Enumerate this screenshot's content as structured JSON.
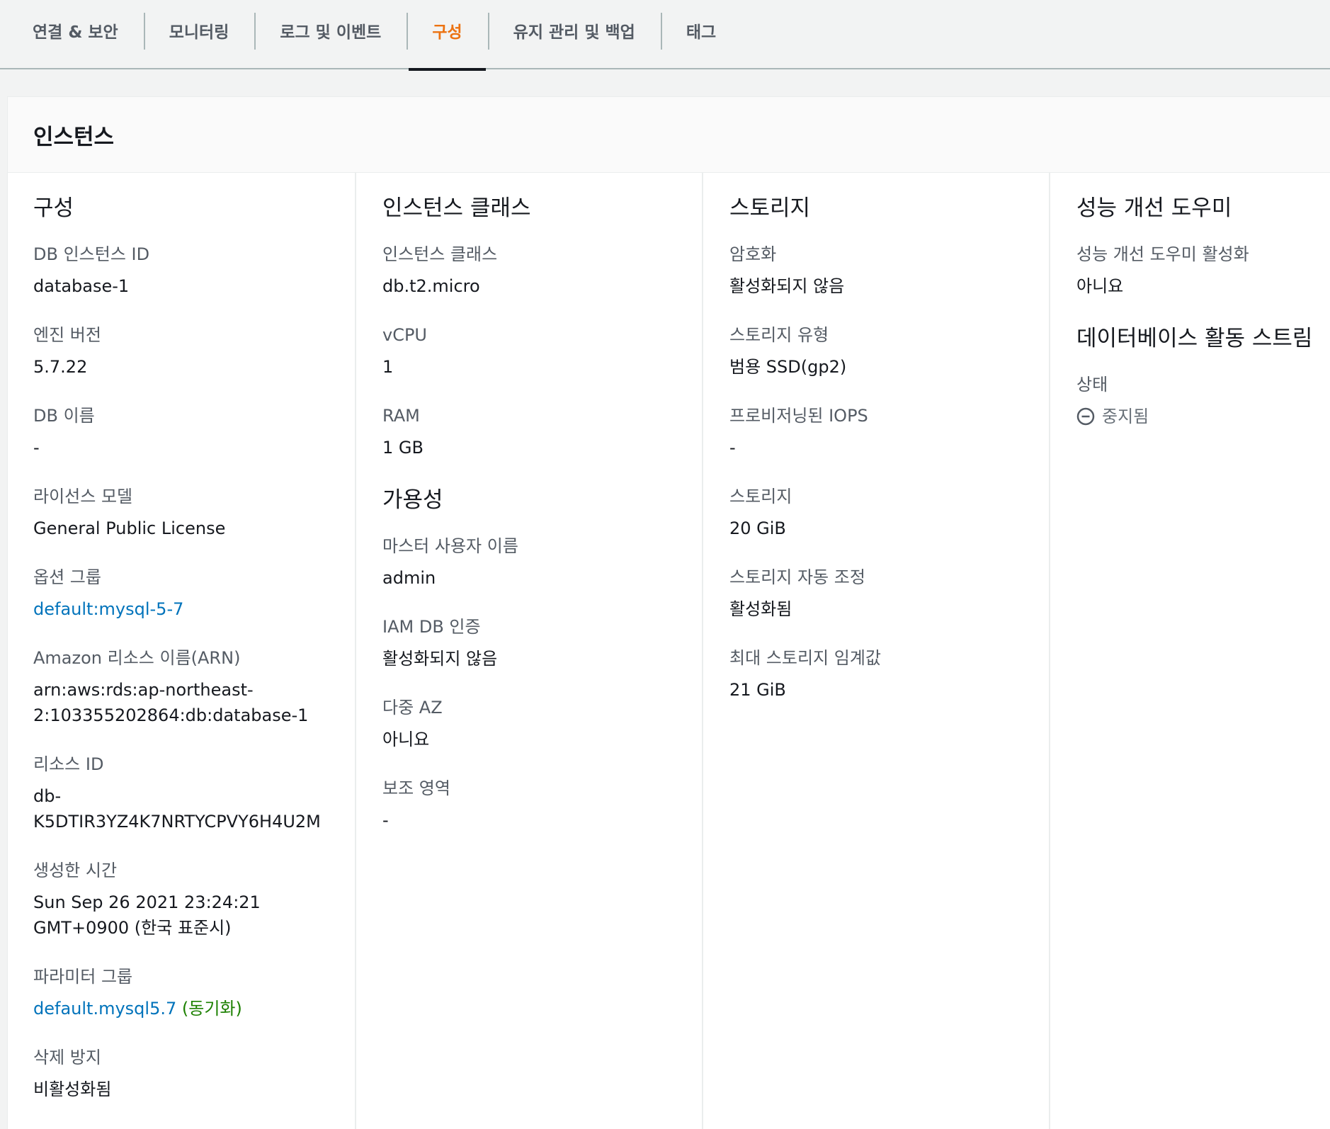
{
  "tabs": [
    {
      "label": "연결 & 보안",
      "active": false
    },
    {
      "label": "모니터링",
      "active": false
    },
    {
      "label": "로그 및 이벤트",
      "active": false
    },
    {
      "label": "구성",
      "active": true
    },
    {
      "label": "유지 관리 및 백업",
      "active": false
    },
    {
      "label": "태그",
      "active": false
    }
  ],
  "panel": {
    "title": "인스턴스"
  },
  "config": {
    "title": "구성",
    "db_instance_id": {
      "label": "DB 인스턴스 ID",
      "value": "database-1"
    },
    "engine_version": {
      "label": "엔진 버전",
      "value": "5.7.22"
    },
    "db_name": {
      "label": "DB 이름",
      "value": "-"
    },
    "license_model": {
      "label": "라이선스 모델",
      "value": "General Public License"
    },
    "option_group": {
      "label": "옵션 그룹",
      "value": "default:mysql-5-7"
    },
    "arn": {
      "label": "Amazon 리소스 이름(ARN)",
      "value_line1": "arn:aws:rds:ap-northeast-",
      "value_line2": "2:103355202864:db:database-1"
    },
    "resource_id": {
      "label": "리소스 ID",
      "value_line1": "db-",
      "value_line2": "K5DTIR3YZ4K7NRTYCPVY6H4U2M"
    },
    "created_time": {
      "label": "생성한 시간",
      "value_line1": "Sun Sep 26 2021 23:24:21",
      "value_line2": "GMT+0900 (한국 표준시)"
    },
    "parameter_group": {
      "label": "파라미터 그룹",
      "value": "default.mysql5.7",
      "sync": "(동기화)"
    },
    "deletion_protection": {
      "label": "삭제 방지",
      "value": "비활성화됨"
    }
  },
  "instance_class": {
    "title": "인스턴스 클래스",
    "class": {
      "label": "인스턴스 클래스",
      "value": "db.t2.micro"
    },
    "vcpu": {
      "label": "vCPU",
      "value": "1"
    },
    "ram": {
      "label": "RAM",
      "value": "1 GB"
    }
  },
  "availability": {
    "title": "가용성",
    "master_user": {
      "label": "마스터 사용자 이름",
      "value": "admin"
    },
    "iam_auth": {
      "label": "IAM DB 인증",
      "value": "활성화되지 않음"
    },
    "multi_az": {
      "label": "다중 AZ",
      "value": "아니요"
    },
    "secondary_zone": {
      "label": "보조 영역",
      "value": "-"
    }
  },
  "storage": {
    "title": "스토리지",
    "encryption": {
      "label": "암호화",
      "value": "활성화되지 않음"
    },
    "storage_type": {
      "label": "스토리지 유형",
      "value": "범용 SSD(gp2)"
    },
    "provisioned_iops": {
      "label": "프로비저닝된 IOPS",
      "value": "-"
    },
    "storage": {
      "label": "스토리지",
      "value": "20 GiB"
    },
    "autoscaling": {
      "label": "스토리지 자동 조정",
      "value": "활성화됨"
    },
    "max_threshold": {
      "label": "최대 스토리지 임계값",
      "value": "21 GiB"
    }
  },
  "performance_insights": {
    "title": "성능 개선 도우미",
    "enabled": {
      "label": "성능 개선 도우미 활성화",
      "value": "아니요"
    }
  },
  "activity_stream": {
    "title": "데이터베이스 활동 스트림",
    "status": {
      "label": "상태",
      "value": "중지됨",
      "icon": "stopped-icon"
    }
  },
  "colors": {
    "accent": "#ec7211",
    "link": "#0073bb",
    "success": "#1d8102",
    "label": "#545b64",
    "text": "#16191f"
  }
}
